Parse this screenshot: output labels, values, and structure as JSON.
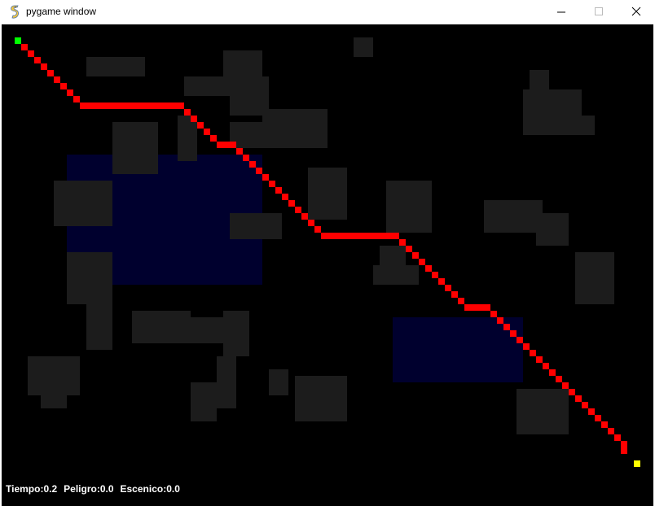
{
  "window": {
    "title": "pygame window",
    "app_icon": "pygame-snake-icon",
    "controls": {
      "minimize_icon": "minimize-icon",
      "maximize_icon": "maximize-icon",
      "close_icon": "close-icon"
    }
  },
  "game": {
    "colors": {
      "background": "#000000",
      "obstacle": "#1c1c1c",
      "water": "#00002e",
      "path": "#ff0000",
      "start": "#00ff00",
      "goal": "#ffff00",
      "hud_text": "#ffffff"
    },
    "hud": {
      "tiempo": "Tiempo:0.2",
      "peligro": "Peligro:0.0",
      "escenico": "Escenico:0.0"
    }
  }
}
